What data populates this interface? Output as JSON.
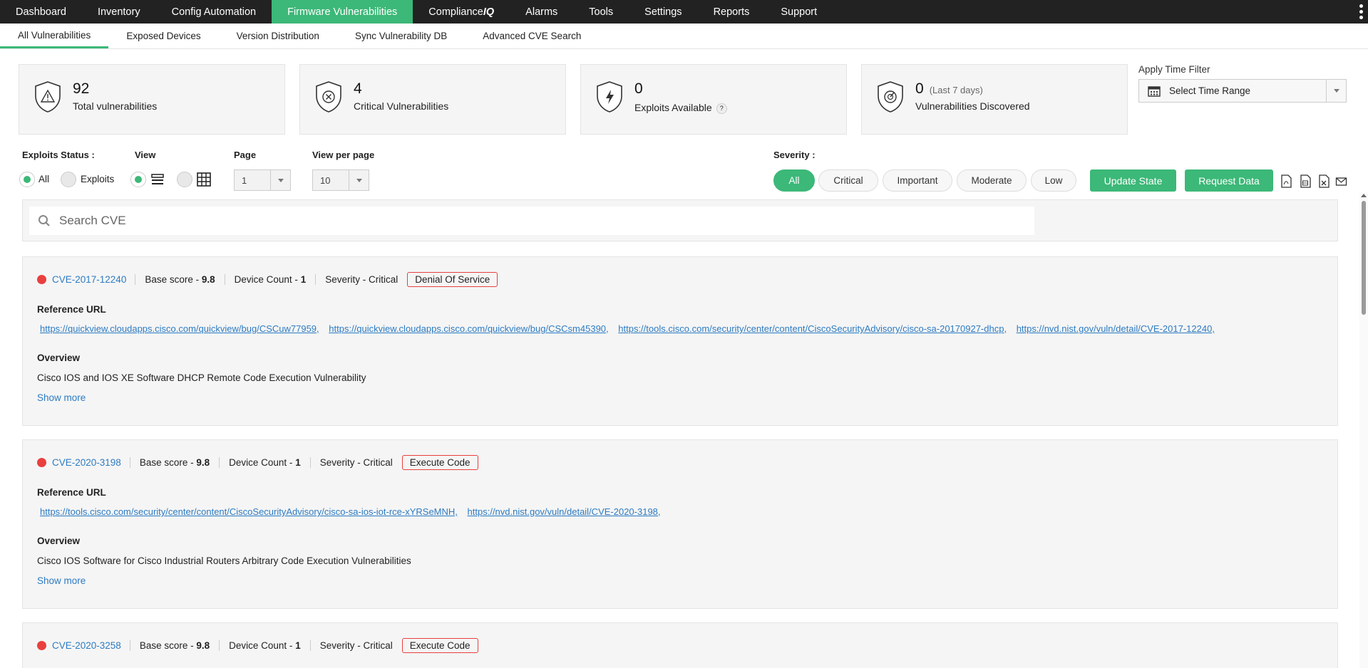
{
  "nav": {
    "items": [
      {
        "label": "Dashboard"
      },
      {
        "label": "Inventory"
      },
      {
        "label": "Config Automation"
      },
      {
        "label": "Firmware Vulnerabilities"
      },
      {
        "label_pre": "Compliance",
        "label_em": "IQ"
      },
      {
        "label": "Alarms"
      },
      {
        "label": "Tools"
      },
      {
        "label": "Settings"
      },
      {
        "label": "Reports"
      },
      {
        "label": "Support"
      }
    ],
    "active": "Firmware Vulnerabilities"
  },
  "subnav": {
    "items": [
      "All Vulnerabilities",
      "Exposed Devices",
      "Version Distribution",
      "Sync Vulnerability DB",
      "Advanced CVE Search"
    ],
    "active": "All Vulnerabilities"
  },
  "stats": {
    "total": {
      "value": "92",
      "label": "Total vulnerabilities"
    },
    "critical": {
      "value": "4",
      "label": "Critical Vulnerabilities"
    },
    "exploits": {
      "value": "0",
      "label": "Exploits Available",
      "help": "?"
    },
    "discovered": {
      "value": "0",
      "note": "(Last 7 days)",
      "label": "Vulnerabilities Discovered"
    }
  },
  "time_filter": {
    "label": "Apply Time Filter",
    "placeholder": "Select Time Range"
  },
  "filters": {
    "exploits_status_label": "Exploits Status :",
    "exploits_options": [
      "All",
      "Exploits"
    ],
    "view_label": "View",
    "page_label": "Page",
    "page_value": "1",
    "per_page_label": "View per page",
    "per_page_value": "10",
    "severity_label": "Severity :",
    "severity_options": [
      "All",
      "Critical",
      "Important",
      "Moderate",
      "Low"
    ],
    "severity_active": "All",
    "update_state": "Update State",
    "request_data": "Request Data"
  },
  "search": {
    "placeholder": "Search CVE"
  },
  "colors": {
    "accent": "#3cb878",
    "critical": "#e8403f",
    "link": "#2d7bc2",
    "nav_bg": "#222222"
  },
  "cves": [
    {
      "id": "CVE-2017-12240",
      "base_score_label": "Base score - ",
      "base_score": "9.8",
      "device_count_label": "Device Count - ",
      "device_count": "1",
      "severity": "Severity - Critical",
      "tag": "Denial Of Service",
      "ref_label": "Reference URL",
      "refs": [
        "https://quickview.cloudapps.cisco.com/quickview/bug/CSCuw77959,",
        "https://quickview.cloudapps.cisco.com/quickview/bug/CSCsm45390,",
        "https://tools.cisco.com/security/center/content/CiscoSecurityAdvisory/cisco-sa-20170927-dhcp,",
        "https://nvd.nist.gov/vuln/detail/CVE-2017-12240,"
      ],
      "overview_label": "Overview",
      "overview": "Cisco IOS and IOS XE Software DHCP Remote Code Execution Vulnerability",
      "show_more": "Show more"
    },
    {
      "id": "CVE-2020-3198",
      "base_score_label": "Base score - ",
      "base_score": "9.8",
      "device_count_label": "Device Count - ",
      "device_count": "1",
      "severity": "Severity - Critical",
      "tag": "Execute Code",
      "ref_label": "Reference URL",
      "refs": [
        "https://tools.cisco.com/security/center/content/CiscoSecurityAdvisory/cisco-sa-ios-iot-rce-xYRSeMNH,",
        "https://nvd.nist.gov/vuln/detail/CVE-2020-3198,"
      ],
      "overview_label": "Overview",
      "overview": "Cisco IOS Software for Cisco Industrial Routers Arbitrary Code Execution Vulnerabilities",
      "show_more": "Show more"
    },
    {
      "id": "CVE-2020-3258",
      "base_score_label": "Base score - ",
      "base_score": "9.8",
      "device_count_label": "Device Count - ",
      "device_count": "1",
      "severity": "Severity - Critical",
      "tag": "Execute Code"
    }
  ]
}
